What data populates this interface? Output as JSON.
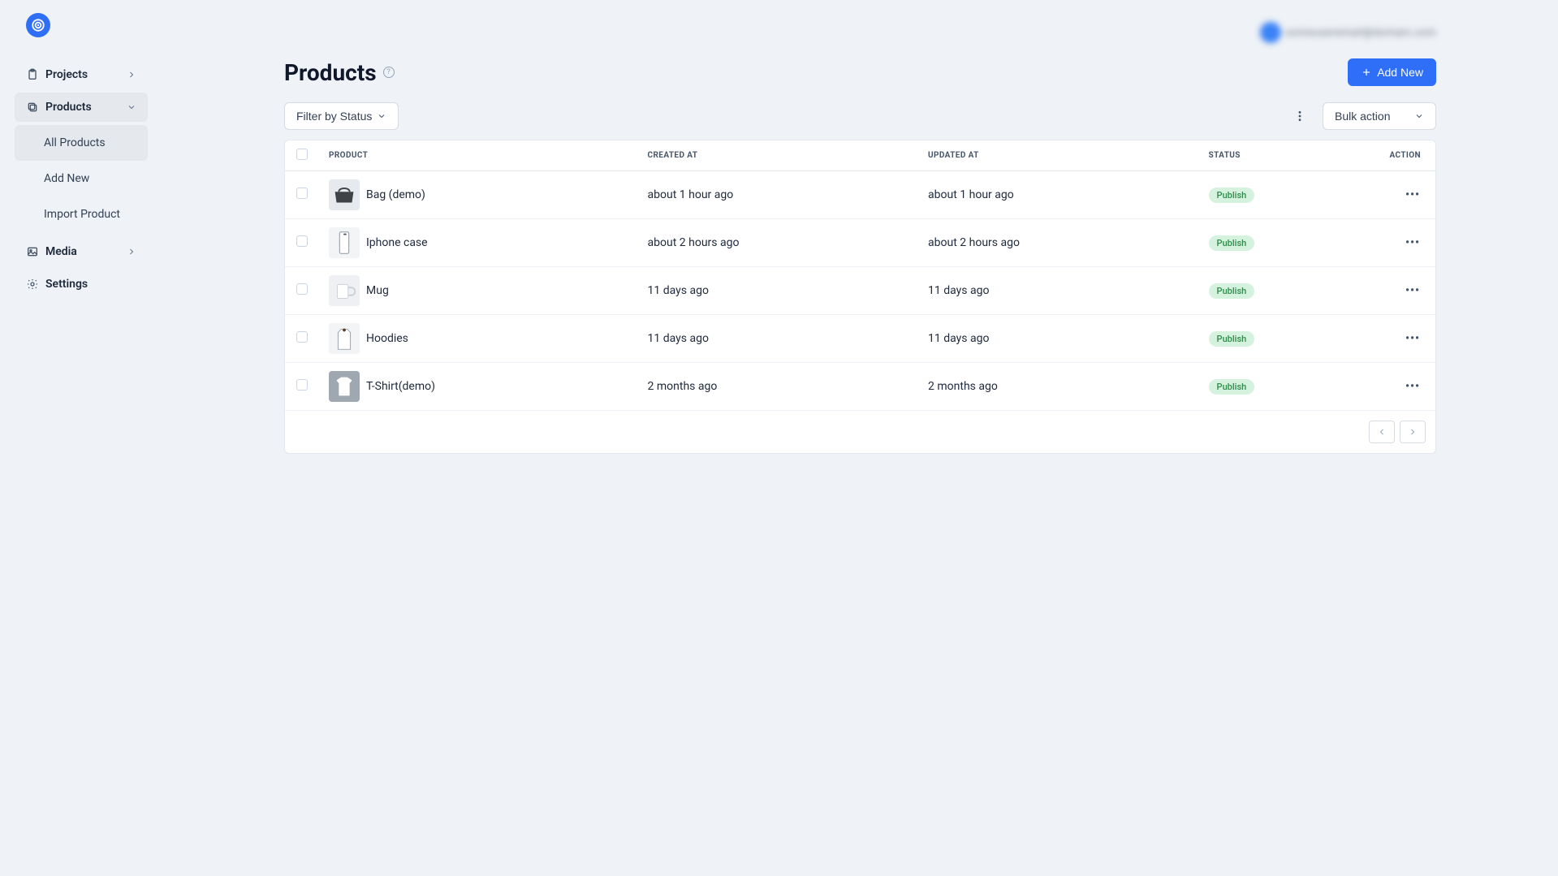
{
  "header": {
    "user_email": "someuseremail@domain.com"
  },
  "sidebar": {
    "projects": "Projects",
    "products": "Products",
    "media": "Media",
    "settings": "Settings",
    "sub": {
      "all_products": "All Products",
      "add_new": "Add New",
      "import_product": "Import Product"
    }
  },
  "page": {
    "title": "Products",
    "add_new": "Add New"
  },
  "toolbar": {
    "filter_label": "Filter by Status",
    "bulk_label": "Bulk action"
  },
  "table": {
    "headers": {
      "product": "PRODUCT",
      "created": "CREATED AT",
      "updated": "UPDATED AT",
      "status": "STATUS",
      "action": "ACTION"
    },
    "rows": [
      {
        "name": "Bag (demo)",
        "created": "about 1 hour ago",
        "updated": "about 1 hour ago",
        "status": "Publish",
        "thumb": "bag"
      },
      {
        "name": "Iphone case",
        "created": "about 2 hours ago",
        "updated": "about 2 hours ago",
        "status": "Publish",
        "thumb": "phone"
      },
      {
        "name": "Mug",
        "created": "11 days ago",
        "updated": "11 days ago",
        "status": "Publish",
        "thumb": "mug"
      },
      {
        "name": "Hoodies",
        "created": "11 days ago",
        "updated": "11 days ago",
        "status": "Publish",
        "thumb": "hoodie"
      },
      {
        "name": "T-Shirt(demo)",
        "created": "2 months ago",
        "updated": "2 months ago",
        "status": "Publish",
        "thumb": "tshirt"
      }
    ]
  }
}
